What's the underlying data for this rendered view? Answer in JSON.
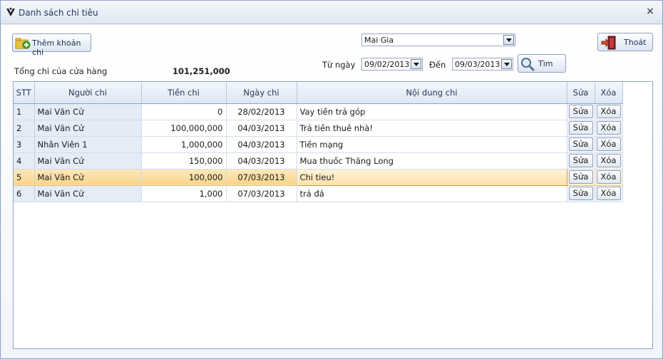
{
  "window": {
    "title": "Danh sách chi tiêu",
    "close_label": "×"
  },
  "toolbar": {
    "add_label": "Thêm khoản chi",
    "exit_label": "Thoát",
    "search_label": "Tìm"
  },
  "filters": {
    "store": "Mai Gia",
    "from_label": "Từ ngày",
    "from_date": "09/02/2013",
    "to_label": "Đến",
    "to_date": "09/03/2013"
  },
  "summary": {
    "label": "Tổng chi của cửa hàng",
    "value": "101,251,000"
  },
  "table": {
    "columns": [
      "STT",
      "Người chi",
      "Tiền chi",
      "Ngày chi",
      "Nội dung chi",
      "Sửa",
      "Xóa"
    ],
    "edit_label": "Sửa",
    "delete_label": "Xóa",
    "rows": [
      {
        "stt": "1",
        "person": "Mai Văn Cử",
        "amount": "0",
        "date": "28/02/2013",
        "content": "Vay tiền trả góp"
      },
      {
        "stt": "2",
        "person": "Mai Văn Cử",
        "amount": "100,000,000",
        "date": "04/03/2013",
        "content": "Trả tiền thuê nhà!"
      },
      {
        "stt": "3",
        "person": "Nhân Viên 1",
        "amount": "1,000,000",
        "date": "04/03/2013",
        "content": "Tiền mạng"
      },
      {
        "stt": "4",
        "person": "Mai Văn Cử",
        "amount": "150,000",
        "date": "04/03/2013",
        "content": "Mua thuốc Thăng Long"
      },
      {
        "stt": "5",
        "person": "Mai Văn Cử",
        "amount": "100,000",
        "date": "07/03/2013",
        "content": "Chi tieu!"
      },
      {
        "stt": "6",
        "person": "Mai Văn Cử",
        "amount": "1,000",
        "date": "07/03/2013",
        "content": "trả đá"
      }
    ],
    "selected_row": 5
  },
  "icons": {
    "app": "logo-icon",
    "add": "folder-add-icon",
    "exit": "exit-door-icon",
    "search": "magnifier-icon",
    "dropdown": "chevron-down-icon"
  },
  "colors": {
    "selected_row": "#f9d58c",
    "selected_border": "#e88e2c",
    "header_bg": "#dde7f4"
  }
}
